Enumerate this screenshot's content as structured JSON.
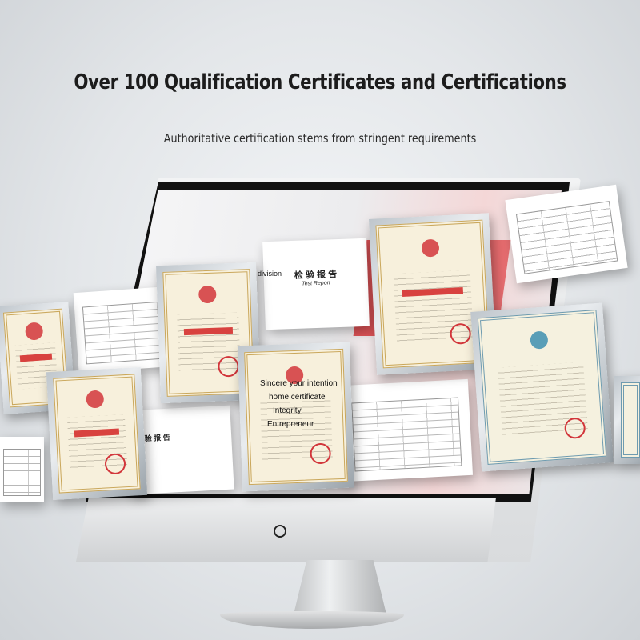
{
  "header": {
    "title": "Over 100 Qualification Certificates and Certifications",
    "subtitle": "Authoritative certification stems from stringent requirements"
  },
  "screen_overlay": {
    "division": "division",
    "line1": "Sincere your intention",
    "line2": "home certificate",
    "line3": "Integrity",
    "line4": "Entrepreneur"
  },
  "reports": {
    "inspection_title": "检 验 报 告",
    "inspection_subtitle": "Test Report",
    "inspection_title_2": "检 验 报 告"
  },
  "colors": {
    "seal_red": "#d2363b",
    "frame_gold": "#c9a65a",
    "screen_red": "#d9363a"
  },
  "icons": {
    "power": "power-button-icon"
  }
}
